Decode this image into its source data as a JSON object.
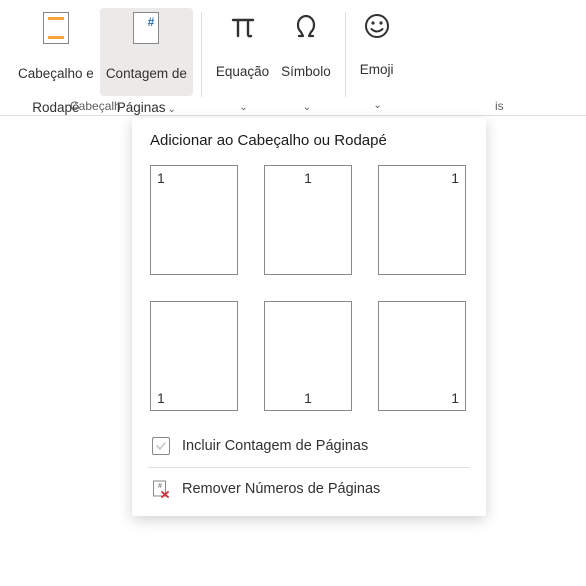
{
  "ribbon": {
    "header_footer": {
      "line1": "Cabeçalho e",
      "line2": "Rodapé"
    },
    "page_count": {
      "line1": "Contagem de",
      "line2": "Páginas"
    },
    "equation": {
      "label": "Equação"
    },
    "symbol": {
      "label": "Símbolo"
    },
    "emoji": {
      "label": "Emoji"
    },
    "group_left_label": "Cabeçalh",
    "group_right_label_fragment": "is",
    "chevron": "⌄"
  },
  "panel": {
    "title": "Adicionar ao Cabeçalho ou Rodapé",
    "sample_number": "1",
    "include_count_label": "Incluir Contagem de Páginas",
    "remove_label": "Remover Números de Páginas",
    "thumbs": [
      {
        "pos": "tl"
      },
      {
        "pos": "tc"
      },
      {
        "pos": "tr"
      },
      {
        "pos": "bl"
      },
      {
        "pos": "bc"
      },
      {
        "pos": "br"
      }
    ]
  }
}
